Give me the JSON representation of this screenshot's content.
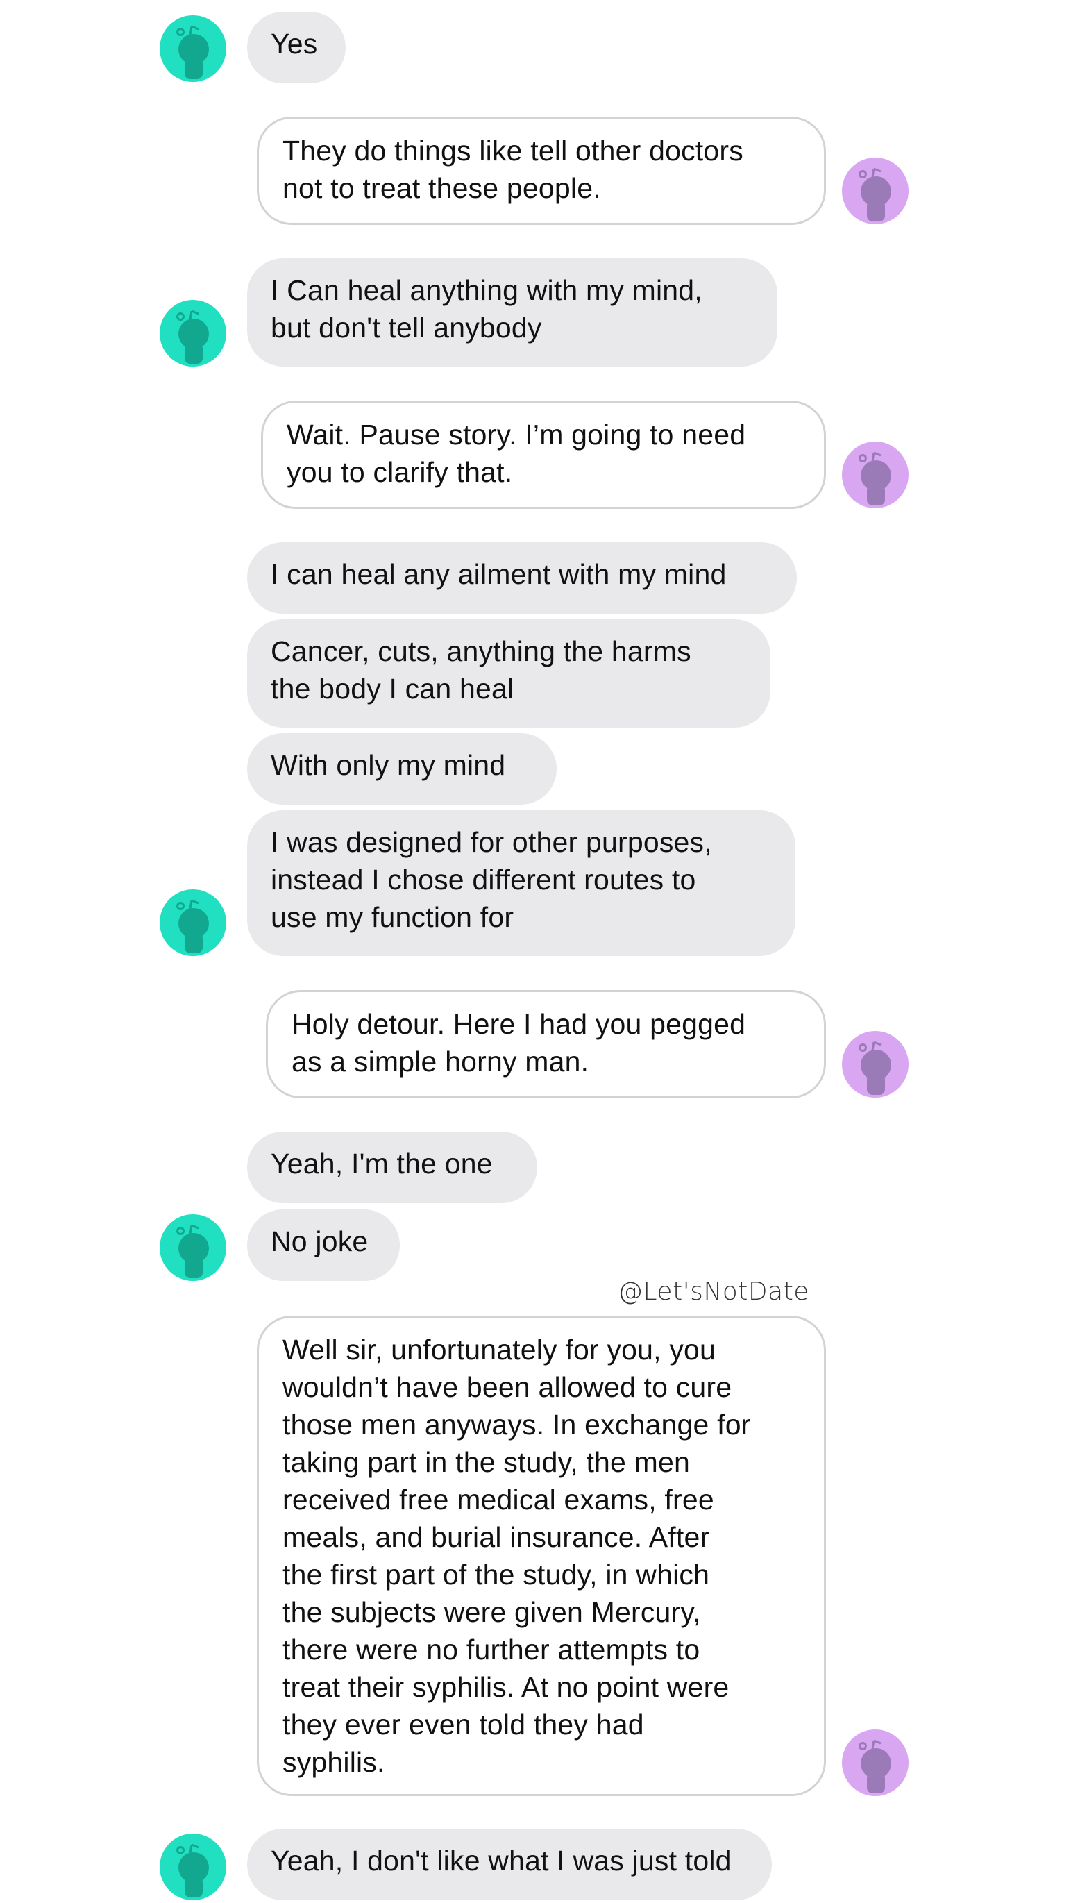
{
  "conversation": {
    "watermark": "@Let'sNotDate",
    "colors": {
      "incoming_bubble": "#e9e9eb",
      "outgoing_bubble_border": "#d3d3d6",
      "other_avatar": "#21e0c2",
      "other_avatar_figure": "#12a88f",
      "self_avatar": "#d9a6f2",
      "self_avatar_figure": "#9a7bb8"
    },
    "avatars": {
      "other_icon": "snoo-avatar-icon",
      "self_icon": "snoo-avatar-icon"
    },
    "messages": [
      {
        "sender": "other",
        "text": "Yes"
      },
      {
        "sender": "self",
        "text": "They do things like tell other doctors\nnot to treat these people."
      },
      {
        "sender": "other",
        "text": "I Can heal anything with my mind,\nbut don't tell anybody"
      },
      {
        "sender": "self",
        "text": "Wait. Pause story. I’m going to need\nyou to clarify that."
      },
      {
        "sender": "other",
        "text": "I can heal any ailment with my mind"
      },
      {
        "sender": "other",
        "text": "Cancer, cuts, anything the harms\nthe body I can heal"
      },
      {
        "sender": "other",
        "text": "With only my mind"
      },
      {
        "sender": "other",
        "text": "I was designed for other purposes,\ninstead I chose different routes to\nuse my function for"
      },
      {
        "sender": "self",
        "text": "Holy detour. Here I had you pegged\nas a simple horny man."
      },
      {
        "sender": "other",
        "text": "Yeah, I'm the one"
      },
      {
        "sender": "other",
        "text": "No joke"
      },
      {
        "sender": "self",
        "text": "Well sir, unfortunately for you, you\nwouldn’t have been allowed to cure\nthose men anyways. In exchange for\ntaking part in the study, the men\nreceived free medical exams, free\nmeals, and burial insurance. After\nthe first part of the study, in which\nthe subjects were given Mercury,\nthere were no further attempts to\ntreat their syphilis. At no point were\nthey ever even told they had\nsyphilis."
      },
      {
        "sender": "other",
        "text": "Yeah, I don't like what I was just told"
      }
    ]
  }
}
